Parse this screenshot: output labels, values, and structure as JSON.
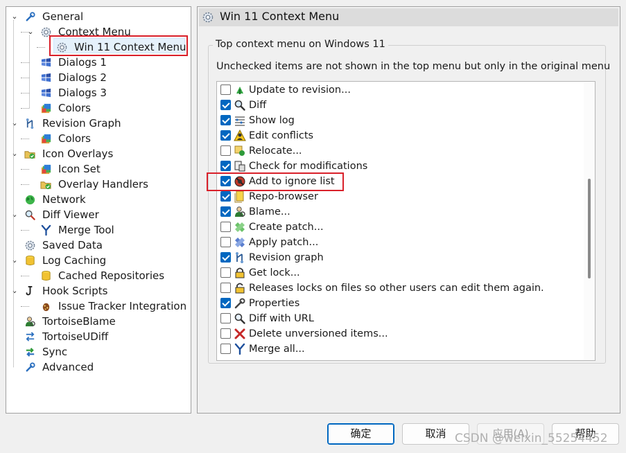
{
  "tree": [
    {
      "label": "General",
      "icon": "wrench-icon",
      "depth": 0,
      "expander": "v"
    },
    {
      "label": "Context Menu",
      "icon": "gear-icon",
      "depth": 1,
      "expander": "v"
    },
    {
      "label": "Win 11 Context Menu",
      "icon": "gear-icon",
      "depth": 2,
      "expander": "",
      "selected": true
    },
    {
      "label": "Dialogs 1",
      "icon": "windows-icon",
      "depth": 1,
      "expander": ""
    },
    {
      "label": "Dialogs 2",
      "icon": "windows-icon",
      "depth": 1,
      "expander": ""
    },
    {
      "label": "Dialogs 3",
      "icon": "windows-icon",
      "depth": 1,
      "expander": ""
    },
    {
      "label": "Colors",
      "icon": "colors-icon",
      "depth": 1,
      "expander": ""
    },
    {
      "label": "Revision Graph",
      "icon": "revision-graph-icon",
      "depth": 0,
      "expander": "v"
    },
    {
      "label": "Colors",
      "icon": "colors-icon",
      "depth": 1,
      "expander": ""
    },
    {
      "label": "Icon Overlays",
      "icon": "folder-overlay-icon",
      "depth": 0,
      "expander": "v"
    },
    {
      "label": "Icon Set",
      "icon": "colors-icon",
      "depth": 1,
      "expander": ""
    },
    {
      "label": "Overlay Handlers",
      "icon": "folder-overlay-icon",
      "depth": 1,
      "expander": ""
    },
    {
      "label": "Network",
      "icon": "globe-icon",
      "depth": 0,
      "expander": ""
    },
    {
      "label": "Diff Viewer",
      "icon": "magnifier-icon",
      "depth": 0,
      "expander": "v"
    },
    {
      "label": "Merge Tool",
      "icon": "merge-icon",
      "depth": 1,
      "expander": ""
    },
    {
      "label": "Saved Data",
      "icon": "gear-icon",
      "depth": 0,
      "expander": ""
    },
    {
      "label": "Log Caching",
      "icon": "database-icon",
      "depth": 0,
      "expander": "v"
    },
    {
      "label": "Cached Repositories",
      "icon": "database-icon",
      "depth": 1,
      "expander": ""
    },
    {
      "label": "Hook Scripts",
      "icon": "hook-icon",
      "depth": 0,
      "expander": "v"
    },
    {
      "label": "Issue Tracker Integration",
      "icon": "bug-icon",
      "depth": 1,
      "expander": ""
    },
    {
      "label": "TortoiseBlame",
      "icon": "blame-icon",
      "depth": 0,
      "expander": ""
    },
    {
      "label": "TortoiseUDiff",
      "icon": "udiff-icon",
      "depth": 0,
      "expander": ""
    },
    {
      "label": "Sync",
      "icon": "sync-icon",
      "depth": 0,
      "expander": ""
    },
    {
      "label": "Advanced",
      "icon": "wrench-icon",
      "depth": 0,
      "expander": ""
    }
  ],
  "panel": {
    "title": "Win 11 Context Menu",
    "group_title": "Top context menu on Windows 11",
    "description": "Unchecked items are not shown in the top menu but only in the original menu"
  },
  "menu_items": [
    {
      "label": "Update to revision...",
      "checked": false,
      "icon": "update-icon"
    },
    {
      "label": "Diff",
      "checked": true,
      "icon": "diff-icon"
    },
    {
      "label": "Show log",
      "checked": true,
      "icon": "log-icon"
    },
    {
      "label": "Edit conflicts",
      "checked": true,
      "icon": "conflict-icon"
    },
    {
      "label": "Relocate...",
      "checked": false,
      "icon": "relocate-icon"
    },
    {
      "label": "Check for modifications",
      "checked": true,
      "icon": "check-modifications-icon"
    },
    {
      "label": "Add to ignore list",
      "checked": true,
      "icon": "ignore-icon"
    },
    {
      "label": "Repo-browser",
      "checked": true,
      "icon": "repo-browser-icon"
    },
    {
      "label": "Blame...",
      "checked": true,
      "icon": "blame-icon"
    },
    {
      "label": "Create patch...",
      "checked": false,
      "icon": "create-patch-icon"
    },
    {
      "label": "Apply patch...",
      "checked": false,
      "icon": "apply-patch-icon"
    },
    {
      "label": "Revision graph",
      "checked": true,
      "icon": "revision-graph-icon"
    },
    {
      "label": "Get lock...",
      "checked": false,
      "icon": "lock-icon"
    },
    {
      "label": "Releases locks on files so other users can edit them again.",
      "checked": false,
      "icon": "unlock-icon"
    },
    {
      "label": "Properties",
      "checked": true,
      "icon": "properties-icon"
    },
    {
      "label": "Diff with URL",
      "checked": false,
      "icon": "diff-url-icon"
    },
    {
      "label": "Delete unversioned items...",
      "checked": false,
      "icon": "delete-icon"
    },
    {
      "label": "Merge all...",
      "checked": false,
      "icon": "merge-icon"
    }
  ],
  "buttons": {
    "ok": "确定",
    "cancel": "取消",
    "apply": "应用(A)",
    "help": "帮助"
  },
  "watermark": "CSDN @weixin_55254452",
  "colors": {
    "accent": "#0067c0",
    "highlight": "#d9202a"
  }
}
